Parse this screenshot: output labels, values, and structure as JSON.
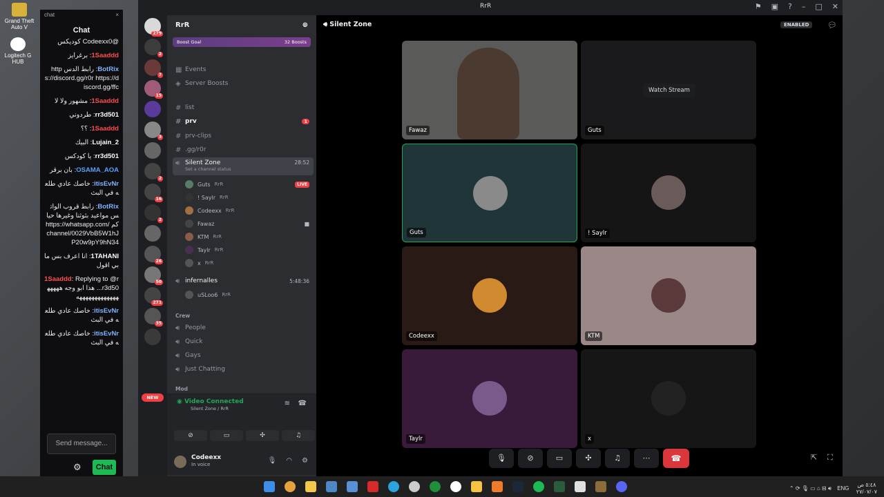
{
  "desktop": {
    "icons": [
      {
        "label": "Grand Theft Auto V",
        "name": "gta-icon"
      },
      {
        "label": "Logitech G HUB",
        "name": "logitech-icon"
      }
    ]
  },
  "chat": {
    "window_label": "chat",
    "title": "Chat",
    "messages": [
      {
        "user": "",
        "text": "@Codeexx0 كوديكس"
      },
      {
        "user": "1Saaddd",
        "text": "برغرايز"
      },
      {
        "user": "BotRix",
        "text": "رابط الدس https://discord.gg/r0r https://discord.gg/ffc"
      },
      {
        "user": "1Saaddd",
        "text": "مشهور ولا لا"
      },
      {
        "user": "rr3d501",
        "text": "طردوني"
      },
      {
        "user": "1Saaddd",
        "text": "؟؟"
      },
      {
        "user": "Lujain_2",
        "text": "البيك"
      },
      {
        "user": "rr3d501",
        "text": "يا كودكس"
      },
      {
        "user": "OSAMA_AOA",
        "text": "بان برقر"
      },
      {
        "user": "itisEvNr",
        "text": "خاصك عادي طلعه في البث"
      },
      {
        "user": "BotRix",
        "text": "رابط قروب الواتس مواعيد بثوثنا وغيرها حياكم https://whatsapp.com/channel/0029VbB5W1hJP20w9pY9hN34"
      },
      {
        "user": "1TAHANI",
        "text": "انا اعرف بس مابي اقول"
      },
      {
        "user": "1Saaddd",
        "text": "Replying to @rr3d50... هذا ابو وجه ههههههههههههههههههه"
      },
      {
        "user": "itisEvNr",
        "text": "خاصك عادي طلعه في البث"
      },
      {
        "user": "itisEvNr",
        "text": "خاصك عادي طلعه في البث"
      }
    ],
    "input_placeholder": "Send message...",
    "send_label": "Chat"
  },
  "discord": {
    "window_title": "RrR",
    "server_name": "RrR",
    "boost_goal": "Boost Goal",
    "boosts": "32 Boosts",
    "channels": {
      "events": "Events",
      "server_boosts": "Server Boosts",
      "list": "list",
      "prv": "prv",
      "prv_badge": "1",
      "prv_clips": "prv-clips",
      "gg": ".gg/r0r",
      "silent_zone": "Silent Zone",
      "silent_status": "Set a channel status",
      "silent_time": "28:52",
      "infernalles": "infernalles",
      "infernalles_time": "5:48:36"
    },
    "voice_members": [
      {
        "name": "Guts",
        "tag": "RrR",
        "live": "LIVE"
      },
      {
        "name": "! Saylr",
        "tag": "RrR"
      },
      {
        "name": "Codeexx",
        "tag": "RrR"
      },
      {
        "name": "Fawaz",
        "tag": ""
      },
      {
        "name": "KTM",
        "tag": "RrR"
      },
      {
        "name": "Taylr",
        "tag": "RrR"
      },
      {
        "name": "x",
        "tag": "RrR"
      }
    ],
    "infernalles_member": {
      "name": "uSLoo6",
      "tag": "RrR"
    },
    "crew_category": "Crew",
    "crew_channels": [
      "People",
      "Quick",
      "Gays",
      "Just Chatting"
    ],
    "mod_category": "Mod",
    "voice_panel": {
      "status": "Video Connected",
      "sub": "Silent Zone / RrR"
    },
    "user": {
      "name": "Codeexx",
      "status": "In voice"
    },
    "stage_title": "Silent Zone",
    "enabled_badge": "ENABLED",
    "tiles": [
      {
        "label": "Fawaz"
      },
      {
        "label": "Guts",
        "watch": "Watch Stream"
      },
      {
        "label": "Guts"
      },
      {
        "label": "! Saylr"
      },
      {
        "label": "Codeexx"
      },
      {
        "label": "KTM"
      },
      {
        "label": "Taylr"
      },
      {
        "label": "x"
      }
    ],
    "server_badges": [
      "279",
      "2",
      "7",
      "15",
      "3",
      "2",
      "16",
      "2",
      "26",
      "50",
      "271",
      "35"
    ],
    "new_badge": "NEW"
  },
  "taskbar": {
    "lang": "ENG",
    "time": "٥:٤٨ ص",
    "date": "٢٧/٠٧/٠٧"
  },
  "colors": {
    "discord_green": "#23a55a",
    "live_red": "#f23f43",
    "chat_button": "#1db954"
  }
}
